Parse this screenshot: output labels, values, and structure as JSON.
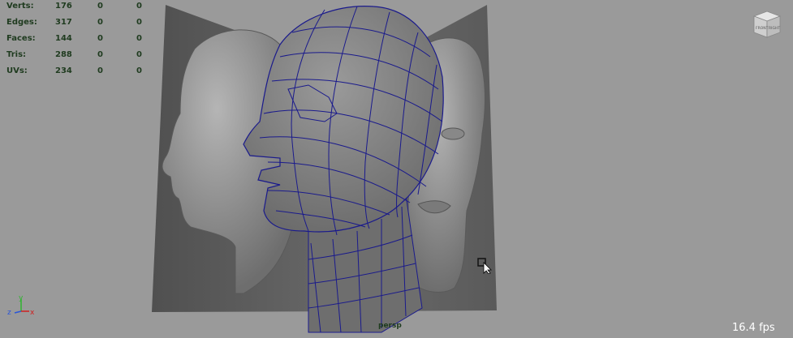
{
  "hud": {
    "rows": [
      {
        "label": "Verts:",
        "v1": "176",
        "v2": "0",
        "v3": "0"
      },
      {
        "label": "Edges:",
        "v1": "317",
        "v2": "0",
        "v3": "0"
      },
      {
        "label": "Faces:",
        "v1": "144",
        "v2": "0",
        "v3": "0"
      },
      {
        "label": "Tris:",
        "v1": "288",
        "v2": "0",
        "v3": "0"
      },
      {
        "label": "UVs:",
        "v1": "234",
        "v2": "0",
        "v3": "0"
      }
    ]
  },
  "viewport": {
    "camera_label": "persp",
    "fps": "16.4 fps",
    "viewcube": {
      "front": "FRONT",
      "right": "RIGHT"
    },
    "axis": {
      "x": "x",
      "y": "y",
      "z": "z"
    }
  },
  "colors": {
    "background": "#9a9a9a",
    "wire": "#1a1a8c",
    "hud_text": "#1f3b1f",
    "fps_text": "#ffffff"
  }
}
